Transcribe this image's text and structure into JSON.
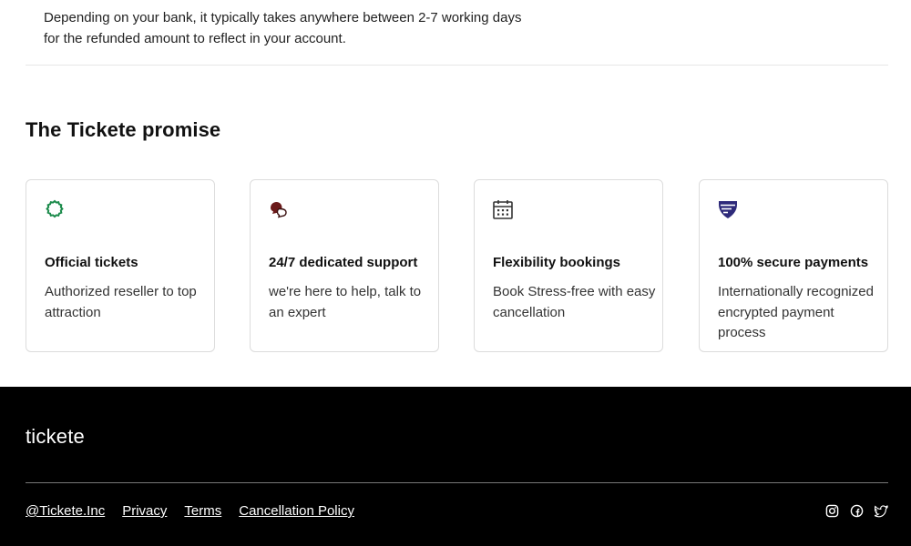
{
  "faq": {
    "answer": "Depending on your bank, it typically takes anywhere between 2-7 working days for the refunded amount to reflect in your account."
  },
  "promise": {
    "title": "The Tickete promise",
    "cards": [
      {
        "icon": "badge-icon",
        "title": "Official tickets",
        "desc": "Authorized reseller to top attraction"
      },
      {
        "icon": "chat-bubbles-icon",
        "title": "24/7 dedicated support",
        "desc": "we're here to help, talk to an expert"
      },
      {
        "icon": "calendar-icon",
        "title": "Flexibility bookings",
        "desc": "Book Stress-free with easy cancellation"
      },
      {
        "icon": "shield-icon",
        "title": "100% secure payments",
        "desc": "Internationally recognized encrypted payment process"
      }
    ]
  },
  "footer": {
    "brand": "tickete",
    "links": [
      "@Tickete.Inc",
      "Privacy",
      "Terms",
      "Cancellation Policy"
    ],
    "social": [
      "instagram-icon",
      "facebook-icon",
      "twitter-icon"
    ]
  },
  "colors": {
    "badge": "#1a8a4a",
    "chat": "#6b1a1a",
    "shield": "#2e2a7a",
    "footer_bg": "#000000"
  }
}
